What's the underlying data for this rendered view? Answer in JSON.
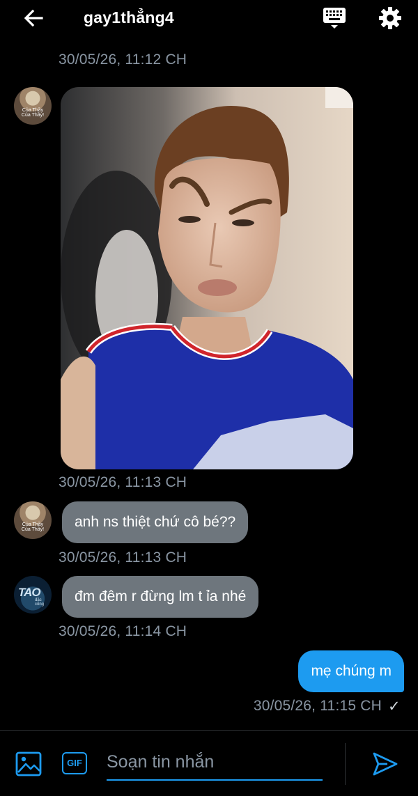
{
  "header": {
    "title": "gay1thẳng4",
    "back_icon": "arrow-left-icon",
    "keyboard_icon": "keyboard-icon",
    "settings_icon": "gear-icon"
  },
  "messages": [
    {
      "type": "incoming-image",
      "timestamp": "30/05/26, 11:12 CH"
    },
    {
      "type": "incoming",
      "text": "anh ns thiệt chứ cô bé??",
      "timestamp": "30/05/26, 11:13 CH"
    },
    {
      "type": "incoming",
      "text": "đm đêm r đừng lm t ỉa nhé",
      "timestamp": "30/05/26, 11:13 CH"
    },
    {
      "type": "outgoing",
      "text": "mẹ chúng m",
      "timestamp": "30/05/26, 11:14 CH"
    },
    {
      "type": "outgoing-status",
      "timestamp": "30/05/26, 11:15 CH",
      "status_mark": "✓"
    }
  ],
  "avatars": {
    "monk_caption": "Của Thầy Của Thầy!",
    "tao_text": "TAO",
    "tao_sub": "đặc công"
  },
  "composer": {
    "placeholder": "Soạn tin nhắn",
    "gif_label": "GIF",
    "image_icon": "image-icon",
    "send_icon": "send-icon"
  },
  "colors": {
    "accent": "#1d9bf0",
    "incoming_bubble": "#6e767d",
    "timestamp": "#8a96a3",
    "background": "#000000"
  }
}
